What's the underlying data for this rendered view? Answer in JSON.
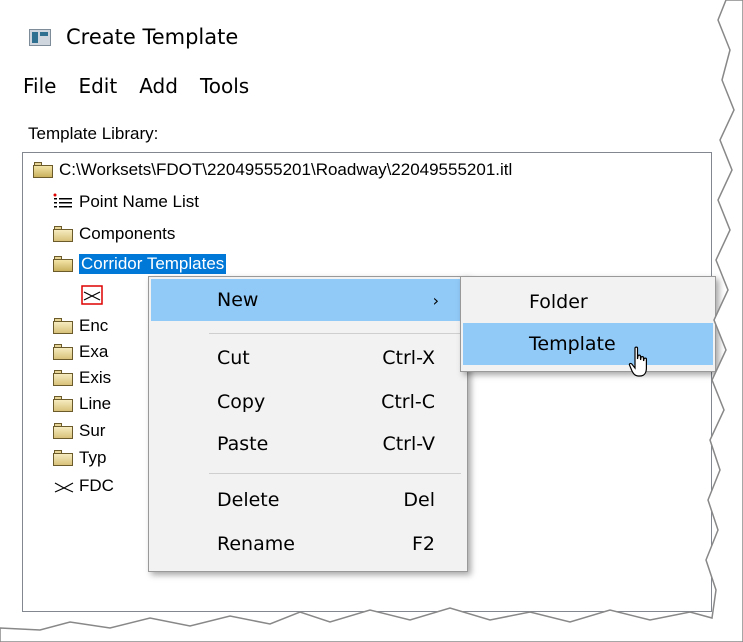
{
  "window": {
    "title": "Create Template",
    "icon": "app-window-icon"
  },
  "menubar": {
    "items": [
      "File",
      "Edit",
      "Add",
      "Tools"
    ]
  },
  "library": {
    "label": "Template Library:"
  },
  "tree": {
    "root": "C:\\Worksets\\FDOT\\22049555201\\Roadway\\22049555201.itl",
    "items": [
      {
        "label": "Point Name List",
        "icon": "point-list-icon"
      },
      {
        "label": "Components",
        "icon": "folder-icon"
      },
      {
        "label": "Corridor Templates",
        "icon": "folder-open-icon",
        "selected": true
      },
      {
        "label": "",
        "icon": "template-icon"
      },
      {
        "label": "Enc",
        "icon": "folder-icon"
      },
      {
        "label": "Exa",
        "icon": "folder-icon"
      },
      {
        "label": "Exis",
        "icon": "folder-icon"
      },
      {
        "label": "Line",
        "icon": "folder-icon"
      },
      {
        "label": "Sur",
        "icon": "folder-icon"
      },
      {
        "label": "Typ",
        "icon": "folder-icon"
      },
      {
        "label": "FDC",
        "icon": "template-icon"
      }
    ]
  },
  "context_menu": {
    "new": {
      "label": "New",
      "arrow": "›"
    },
    "cut": {
      "label": "Cut",
      "shortcut": "Ctrl-X"
    },
    "copy": {
      "label": "Copy",
      "shortcut": "Ctrl-C"
    },
    "paste": {
      "label": "Paste",
      "shortcut": "Ctrl-V"
    },
    "delete": {
      "label": "Delete",
      "shortcut": "Del"
    },
    "rename": {
      "label": "Rename",
      "shortcut": "F2"
    }
  },
  "submenu": {
    "folder": "Folder",
    "template": "Template"
  },
  "colors": {
    "selection": "#0078d7",
    "menu_highlight": "#91c9f7",
    "menu_bg": "#f2f2f2"
  }
}
